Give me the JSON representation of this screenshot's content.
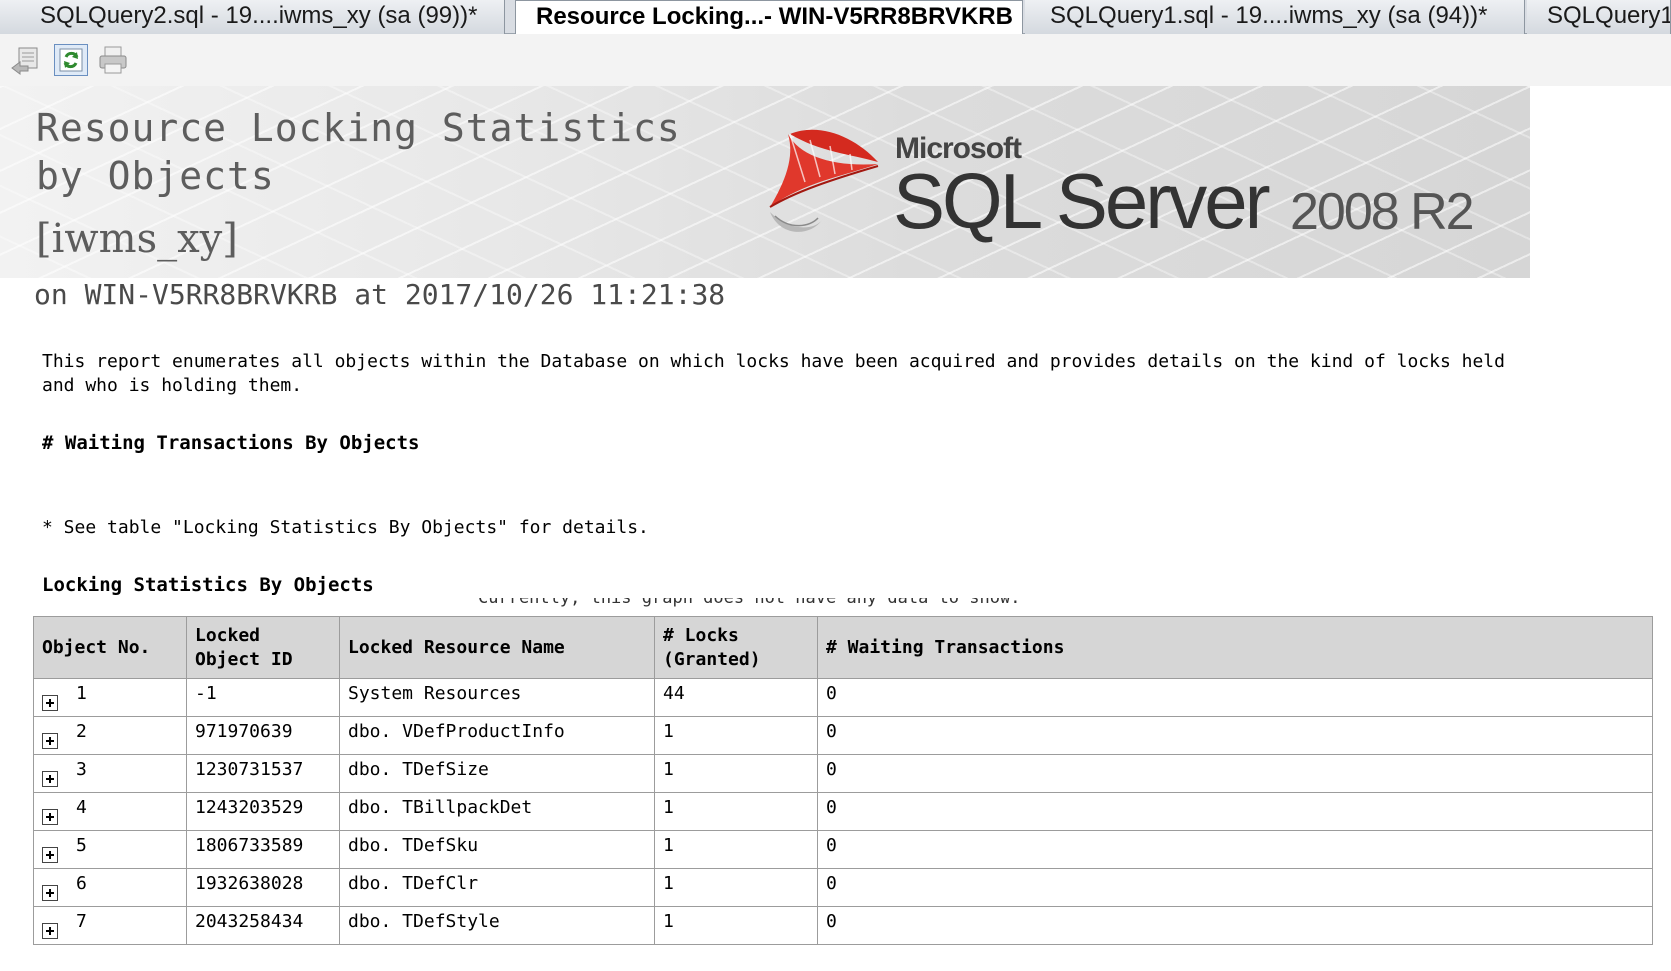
{
  "tabs": [
    {
      "label": "SQLQuery2.sql - 19....iwms_xy (sa (99))*",
      "active": false
    },
    {
      "label": "Resource Locking...- WIN-V5RR8BRVKRB",
      "active": true
    },
    {
      "label": "SQLQuery1.sql - 19....iwms_xy (sa (94))*",
      "active": false
    },
    {
      "label": "SQLQuery1",
      "active": false
    }
  ],
  "toolbar": {
    "icons": [
      "back-icon",
      "refresh-icon",
      "print-icon"
    ]
  },
  "header": {
    "title": "Resource Locking Statistics by Objects",
    "database": "[iwms_xy]",
    "subtitle": "on WIN-V5RR8BRVKRB at 2017/10/26 11:21:38"
  },
  "logo": {
    "microsoft": "Microsoft",
    "product": "SQL Server",
    "version": "2008 R2"
  },
  "description": "This report enumerates all objects within the Database on which locks have been acquired and provides details on the kind of locks held and who is holding them.",
  "waiting_section": {
    "heading": "# Waiting Transactions By Objects",
    "no_data": "Currently, this graph does not have any data to show.",
    "note": "* See table \"Locking Statistics By Objects\" for details."
  },
  "locking_section": {
    "heading": "Locking Statistics By Objects",
    "columns": [
      "Object No.",
      "Locked Object ID",
      "Locked Resource Name",
      "# Locks (Granted)",
      "# Waiting Transactions"
    ],
    "rows": [
      {
        "no": "1",
        "id": "-1",
        "name": "System Resources",
        "locks": "44",
        "waiting": "0"
      },
      {
        "no": "2",
        "id": "971970639",
        "name": "dbo. VDefProductInfo",
        "locks": "1",
        "waiting": "0"
      },
      {
        "no": "3",
        "id": "1230731537",
        "name": "dbo. TDefSize",
        "locks": "1",
        "waiting": "0"
      },
      {
        "no": "4",
        "id": "1243203529",
        "name": "dbo. TBillpackDet",
        "locks": "1",
        "waiting": "0"
      },
      {
        "no": "5",
        "id": "1806733589",
        "name": "dbo. TDefSku",
        "locks": "1",
        "waiting": "0"
      },
      {
        "no": "6",
        "id": "1932638028",
        "name": "dbo. TDefClr",
        "locks": "1",
        "waiting": "0"
      },
      {
        "no": "7",
        "id": "2043258434",
        "name": "dbo. TDefStyle",
        "locks": "1",
        "waiting": "0"
      }
    ]
  }
}
